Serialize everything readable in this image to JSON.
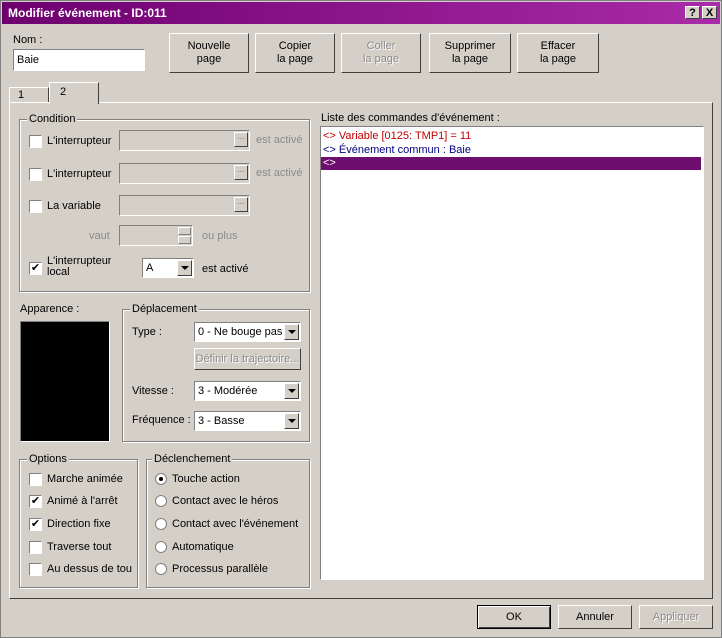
{
  "window": {
    "title": "Modifier événement - ID:011",
    "help_label": "?",
    "close_label": "X"
  },
  "name": {
    "label": "Nom :",
    "value": "Baie"
  },
  "page_buttons": {
    "new_page": "Nouvelle\npage",
    "copy_page": "Copier\nla page",
    "paste_page": "Coller\nla page",
    "delete_page": "Supprimer\nla page",
    "clear_page": "Effacer\nla page"
  },
  "tabs": [
    "1",
    "2"
  ],
  "condition": {
    "title": "Condition",
    "switch1_label": "L'interrupteur",
    "switch1_suffix": "est activé",
    "switch2_label": "L'interrupteur",
    "switch2_suffix": "est activé",
    "variable_label": "La variable",
    "value_label": "vaut",
    "value_suffix": "ou plus",
    "local_label": "L'interrupteur\nlocal",
    "local_value": "A",
    "local_suffix": "est activé",
    "local_checked_mark": "✔"
  },
  "appearance": {
    "label": "Apparence :"
  },
  "movement": {
    "title": "Déplacement",
    "type_label": "Type :",
    "type_value": "0 - Ne bouge pas",
    "route_button": "Définir la trajectoire...",
    "speed_label": "Vitesse :",
    "speed_value": "3 - Modérée",
    "freq_label": "Fréquence :",
    "freq_value": "3 - Basse"
  },
  "options": {
    "title": "Options",
    "items": [
      {
        "label": "Marche animée",
        "mark": ""
      },
      {
        "label": "Animé à l'arrêt",
        "mark": "✔"
      },
      {
        "label": "Direction fixe",
        "mark": "✔"
      },
      {
        "label": "Traverse tout",
        "mark": ""
      },
      {
        "label": "Au dessus de tou",
        "mark": ""
      }
    ]
  },
  "trigger": {
    "title": "Déclenchement",
    "items": [
      "Touche action",
      "Contact avec le héros",
      "Contact avec l'événement",
      "Automatique",
      "Processus parallèle"
    ],
    "selected": 0
  },
  "commands": {
    "label": "Liste des commandes d'événement :",
    "lines": [
      "<> Variable [0125: TMP1] = 11",
      "<> Événement commun : Baie",
      "<>"
    ],
    "colors": [
      "#c00000",
      "#000080",
      "#ffffff"
    ]
  },
  "footer": {
    "ok": "OK",
    "cancel": "Annuler",
    "apply": "Appliquer"
  }
}
